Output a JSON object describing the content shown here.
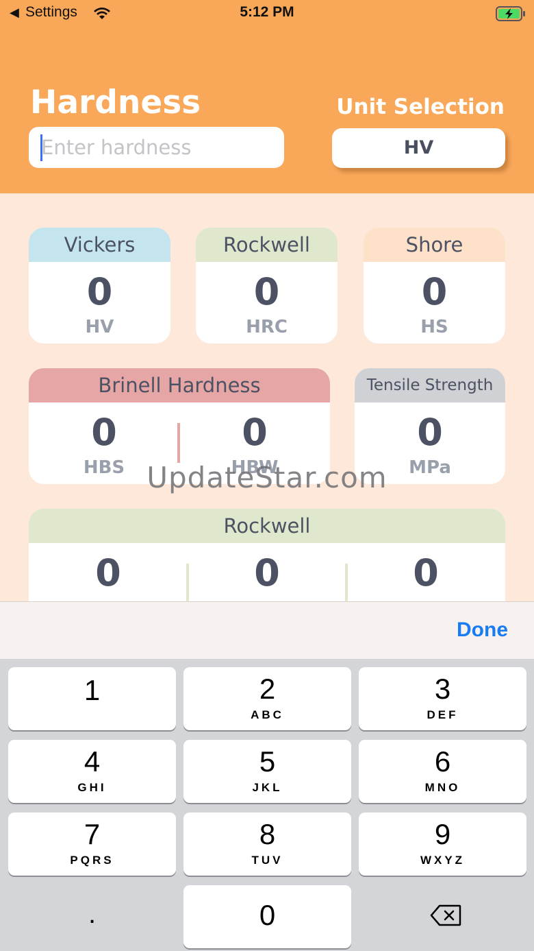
{
  "status_bar": {
    "back_label": "Settings",
    "time": "5:12 PM"
  },
  "header": {
    "title": "Hardness",
    "unit_title": "Unit Selection",
    "input_placeholder": "Enter hardness",
    "selected_unit": "HV"
  },
  "cards": {
    "vickers": {
      "title": "Vickers",
      "value": "0",
      "unit": "HV"
    },
    "rockwell": {
      "title": "Rockwell",
      "value": "0",
      "unit": "HRC"
    },
    "shore": {
      "title": "Shore",
      "value": "0",
      "unit": "HS"
    },
    "brinell": {
      "title": "Brinell Hardness",
      "values": [
        {
          "value": "0",
          "unit": "HBS"
        },
        {
          "value": "0",
          "unit": "HBW"
        }
      ]
    },
    "tensile": {
      "title": "Tensile Strength",
      "value": "0",
      "unit": "MPa"
    },
    "rockwell_scales": {
      "title": "Rockwell",
      "values": [
        "0",
        "0",
        "0"
      ]
    }
  },
  "watermark": "UpdateStar.com",
  "keyboard": {
    "done_label": "Done",
    "keys": [
      {
        "num": "1",
        "letters": ""
      },
      {
        "num": "2",
        "letters": "ABC"
      },
      {
        "num": "3",
        "letters": "DEF"
      },
      {
        "num": "4",
        "letters": "GHI"
      },
      {
        "num": "5",
        "letters": "JKL"
      },
      {
        "num": "6",
        "letters": "MNO"
      },
      {
        "num": "7",
        "letters": "PQRS"
      },
      {
        "num": "8",
        "letters": "TUV"
      },
      {
        "num": "9",
        "letters": "WXYZ"
      },
      {
        "num": "0",
        "letters": ""
      }
    ],
    "decimal": "."
  },
  "colors": {
    "header_bg": "#f9a758",
    "page_bg": "#fde8d9",
    "vickers": "#c4e4ee",
    "rockwell": "#dfe7cd",
    "shore": "#fde1c8",
    "brinell": "#e6a6a6",
    "tensile": "#cfd1d4",
    "done": "#1a7cf2"
  },
  "icons": [
    "back-chevron-icon",
    "wifi-icon",
    "battery-charging-icon",
    "backspace-icon"
  ]
}
